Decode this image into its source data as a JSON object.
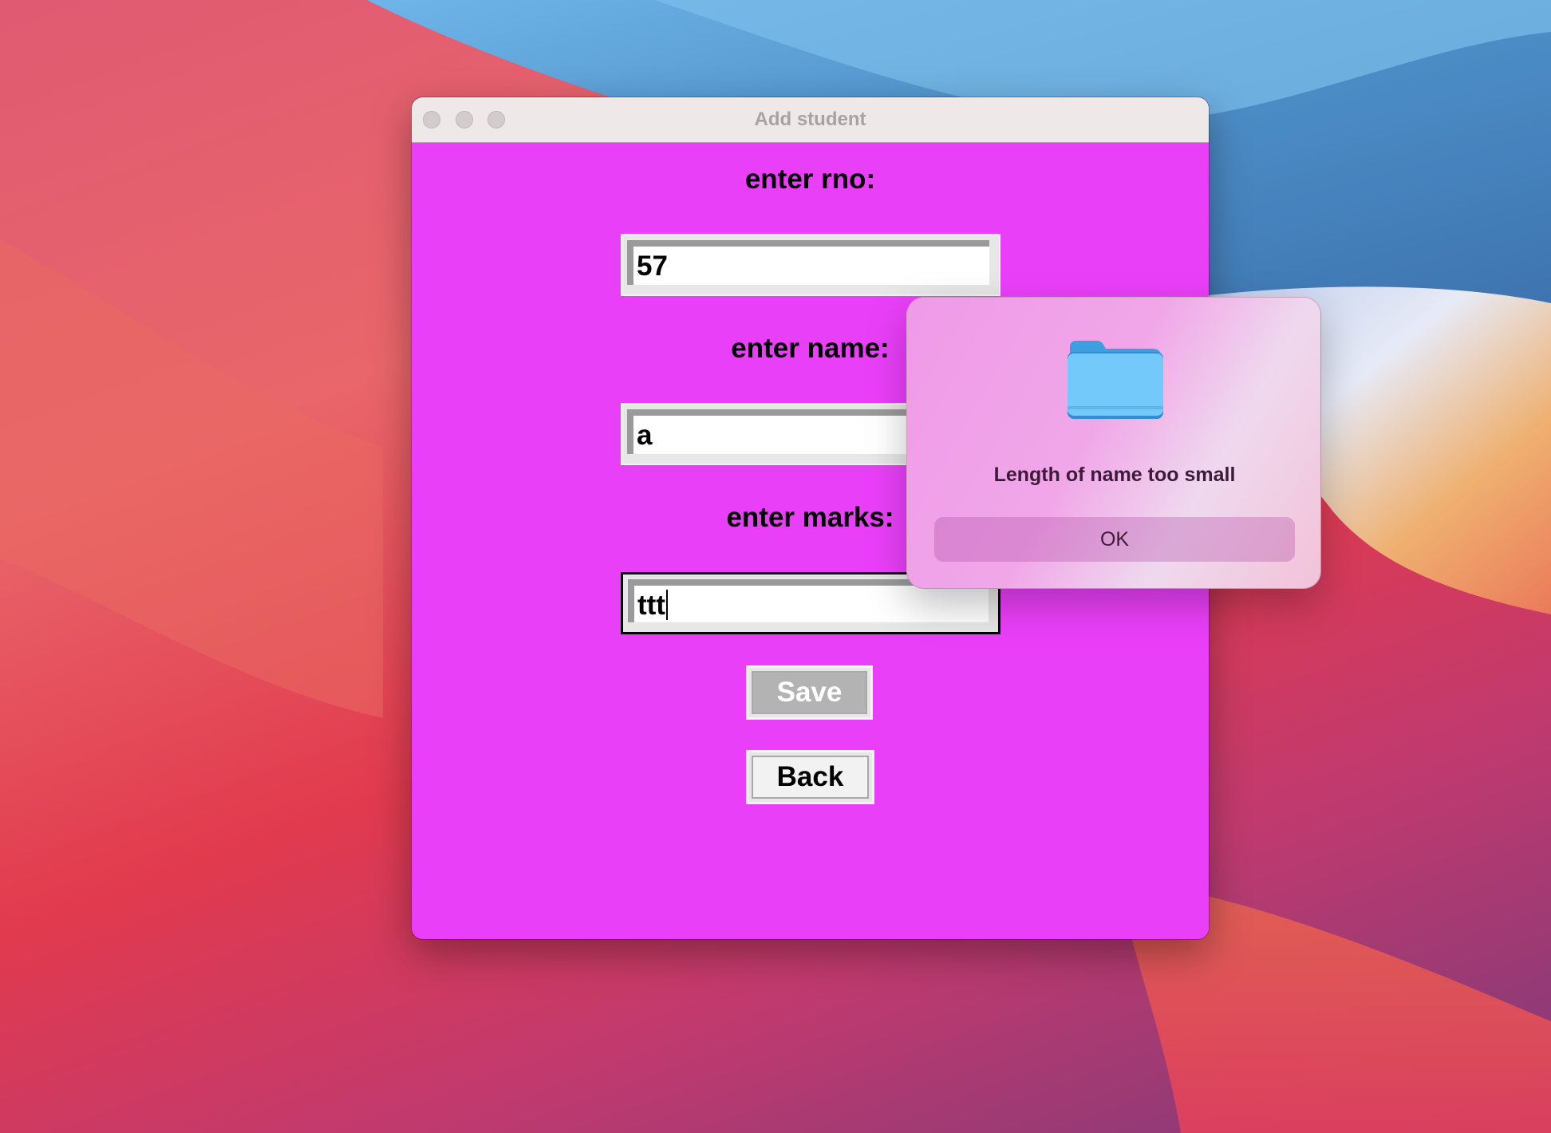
{
  "window": {
    "title": "Add student"
  },
  "form": {
    "rno_label": "enter rno:",
    "rno_value": "57",
    "name_label": "enter name:",
    "name_value": "a",
    "marks_label": "enter marks:",
    "marks_value": "ttt",
    "save_label": "Save",
    "back_label": "Back"
  },
  "alert": {
    "icon": "folder-icon",
    "message": "Length of name too small",
    "ok_label": "OK"
  },
  "colors": {
    "window_background": "#ea3ff9",
    "titlebar": "#efe8e8",
    "alert_text": "#3e1a3a",
    "folder_blue": "#6cc3f7"
  }
}
